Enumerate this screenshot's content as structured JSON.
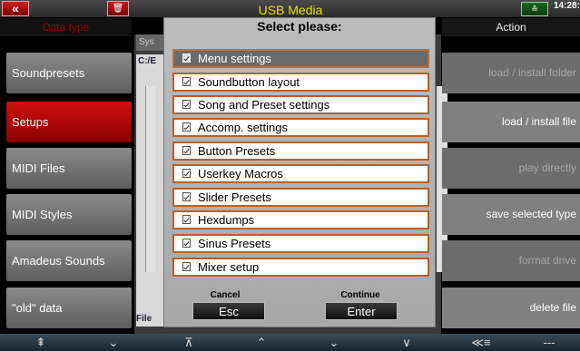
{
  "header": {
    "title": "USB Media",
    "clock": "14:28:",
    "back_icon": "«",
    "delete_icon": "🗑",
    "mode_icon": "≙"
  },
  "columns": {
    "left_header": "Data type",
    "right_header": "Action",
    "tab": "Sys"
  },
  "data_types": [
    {
      "label": "Soundpresets"
    },
    {
      "label": "Setups"
    },
    {
      "label": "MIDI Files"
    },
    {
      "label": "MIDI Styles"
    },
    {
      "label": "Amadeus Sounds"
    },
    {
      "label": "\"old\" data"
    }
  ],
  "actions": [
    {
      "label": "load / install folder"
    },
    {
      "label": "load / install file"
    },
    {
      "label": "play directly"
    },
    {
      "label": "save selected type"
    },
    {
      "label": "format drive"
    },
    {
      "label": "delete file"
    }
  ],
  "path": "C:/E",
  "file_label": "File",
  "dialog": {
    "title": "Select please:",
    "items": [
      {
        "label": "Menu settings"
      },
      {
        "label": "Soundbutton layout"
      },
      {
        "label": "Song and Preset settings"
      },
      {
        "label": "Accomp. settings"
      },
      {
        "label": "Button Presets"
      },
      {
        "label": "Userkey Macros"
      },
      {
        "label": "Slider Presets"
      },
      {
        "label": "Hexdumps"
      },
      {
        "label": "Sinus Presets"
      },
      {
        "label": "Mixer setup"
      }
    ],
    "cancel_label": "Cancel",
    "cancel_button": "Esc",
    "continue_label": "Continue",
    "continue_button": "Enter"
  },
  "nav": [
    "⇞",
    "⌄",
    "⊼",
    "⌃",
    "⌄",
    "∨",
    "≪≡",
    "---"
  ]
}
